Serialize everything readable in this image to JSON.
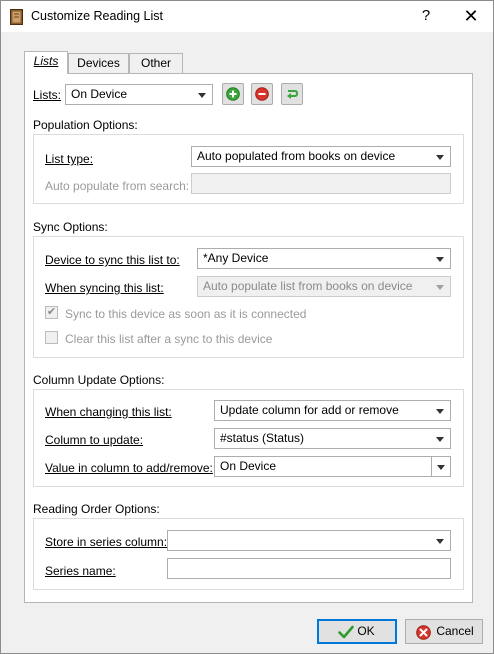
{
  "window": {
    "title": "Customize Reading List",
    "help_label": "?",
    "close_label": "✕"
  },
  "tabs": [
    {
      "label": "Lists"
    },
    {
      "label": "Devices"
    },
    {
      "label": "Other"
    }
  ],
  "lists": {
    "label": "Lists:",
    "selected": "On Device",
    "icons": [
      "add-icon",
      "remove-icon",
      "rename-icon"
    ]
  },
  "population": {
    "heading": "Population Options:",
    "list_type_label": "List type:",
    "list_type_value": "Auto populated from books on device",
    "auto_search_label": "Auto populate from search:",
    "auto_search_value": ""
  },
  "sync": {
    "heading": "Sync Options:",
    "device_label": "Device to sync this list to:",
    "device_value": "*Any Device",
    "when_label": "When syncing this list:",
    "when_value": "Auto populate list from books on device",
    "check1_label": "Sync to this device as soon as it is connected",
    "check1_checked": true,
    "check2_label": "Clear this list after a sync to this device",
    "check2_checked": false
  },
  "column_update": {
    "heading": "Column Update Options:",
    "changing_label": "When changing this list:",
    "changing_value": "Update column for add or remove",
    "column_label": "Column to update:",
    "column_value": "#status (Status)",
    "value_label": "Value in column to add/remove:",
    "value_value": "On Device"
  },
  "reading_order": {
    "heading": "Reading Order Options:",
    "series_column_label": "Store in series column:",
    "series_column_value": "",
    "series_name_label": "Series name:",
    "series_name_value": ""
  },
  "buttons": {
    "ok": "OK",
    "cancel": "Cancel"
  },
  "colors": {
    "accent": "#0078d7",
    "add_green": "#3aa63a",
    "remove_red": "#d9342b"
  }
}
